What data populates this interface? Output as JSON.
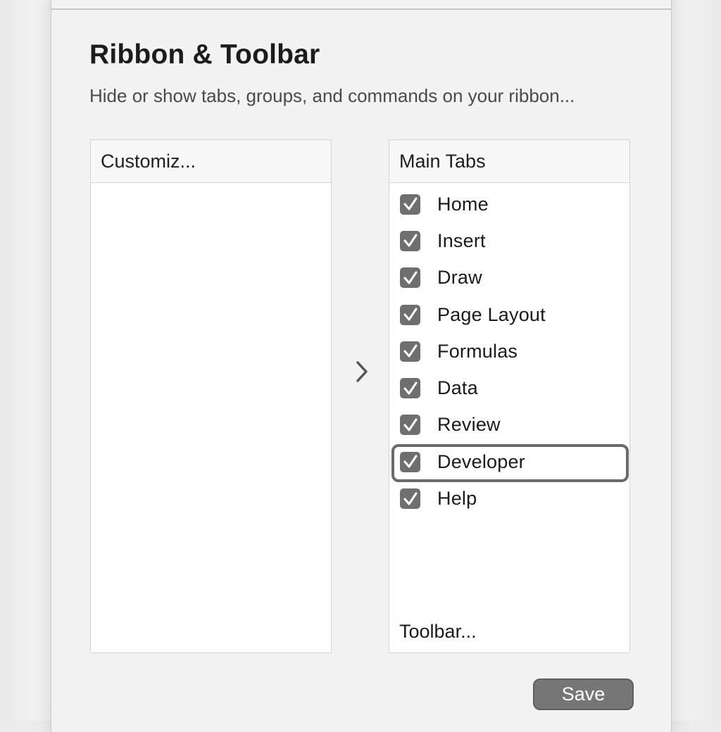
{
  "dialog": {
    "title": "Ribbon & Toolbar",
    "subtitle": "Hide or show tabs, groups, and commands on your ribbon..."
  },
  "left_panel": {
    "header": "Customiz..."
  },
  "transfer_button": {
    "icon": "chevron-right-icon"
  },
  "right_panel": {
    "header": "Main Tabs",
    "tabs": [
      {
        "label": "Home",
        "checked": true
      },
      {
        "label": "Insert",
        "checked": true
      },
      {
        "label": "Draw",
        "checked": true
      },
      {
        "label": "Page Layout",
        "checked": true
      },
      {
        "label": "Formulas",
        "checked": true
      },
      {
        "label": "Data",
        "checked": true
      },
      {
        "label": "Review",
        "checked": true
      },
      {
        "label": "Developer",
        "checked": true,
        "selected": true
      },
      {
        "label": "Help",
        "checked": true
      }
    ],
    "footer_link": "Toolbar..."
  },
  "buttons": {
    "save_label": "Save"
  },
  "colors": {
    "window_bg": "#f2f2f2",
    "checkbox_fill": "#6f6f6f",
    "button_fill": "#767676"
  }
}
